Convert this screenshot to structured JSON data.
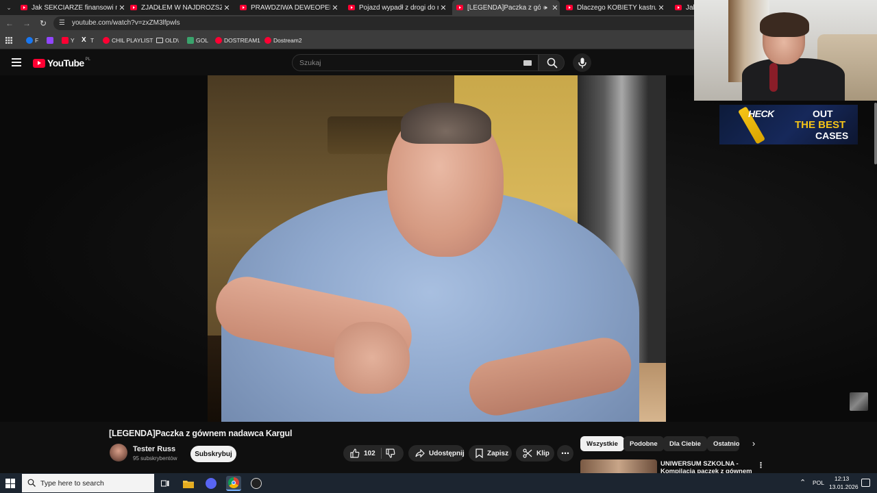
{
  "browser": {
    "tabs": [
      {
        "title": "Jak SEKCIARZE finansowi niszcz",
        "active": false
      },
      {
        "title": "ZJADŁEM W NAJDROŻSZEJ I NAJ",
        "active": false
      },
      {
        "title": "PRAWDZIWA DEWEOPERKA - P",
        "active": false
      },
      {
        "title": "Pojazd wypadł z drogi do rowu",
        "active": false
      },
      {
        "title": "[LEGENDA]Paczka z gówne",
        "active": true
      },
      {
        "title": "Dlaczego KOBIETY kastrują face",
        "active": false
      },
      {
        "title": "Jak",
        "active": false
      }
    ],
    "url": "youtube.com/watch?v=zxZM3lfpwls",
    "bookmarks": [
      {
        "label": "F",
        "icon": "facebook-icon"
      },
      {
        "label": "",
        "icon": "twitch-icon"
      },
      {
        "label": "Y",
        "icon": "youtube-icon"
      },
      {
        "label": "T",
        "icon": "x-icon"
      },
      {
        "label": "CHIL PLAYLIST",
        "icon": "youtube-icon"
      },
      {
        "label": "OLD\\",
        "icon": "folder-icon"
      },
      {
        "label": "GOL",
        "icon": "gol-icon"
      },
      {
        "label": "DOSTREAM1",
        "icon": "youtube-icon"
      },
      {
        "label": "Dostream2",
        "icon": "youtube-icon"
      }
    ]
  },
  "youtube": {
    "logo_text": "YouTube",
    "logo_country": "PL",
    "search_placeholder": "Szukaj",
    "video_title": "[LEGENDA]Paczka z gównem nadawca Kargul",
    "channel_name": "Tester Russ",
    "subscribers": "95 subskrybentów",
    "subscribe_label": "Subskrybuj",
    "like_count": "102",
    "share_label": "Udostępnij",
    "save_label": "Zapisz",
    "clip_label": "Klip",
    "chips": [
      "Wszystkie",
      "Podobne",
      "Dla Ciebie",
      "Ostatnio"
    ],
    "recommendation_title": "UNIWERSUM SZKOLNA - Kompilacja paczek z gównem"
  },
  "overlay": {
    "ad_line1": "HECK",
    "ad_line1b": "OUT",
    "ad_line2": "THE BEST",
    "ad_line3": "CASES"
  },
  "taskbar": {
    "search_placeholder": "Type here to search",
    "language": "POL",
    "time": "12:13",
    "date": "13.01.2026"
  },
  "colors": {
    "youtube_red": "#ff0033",
    "background": "#0f0f0f",
    "chip_selected": "#f1f1f1"
  }
}
